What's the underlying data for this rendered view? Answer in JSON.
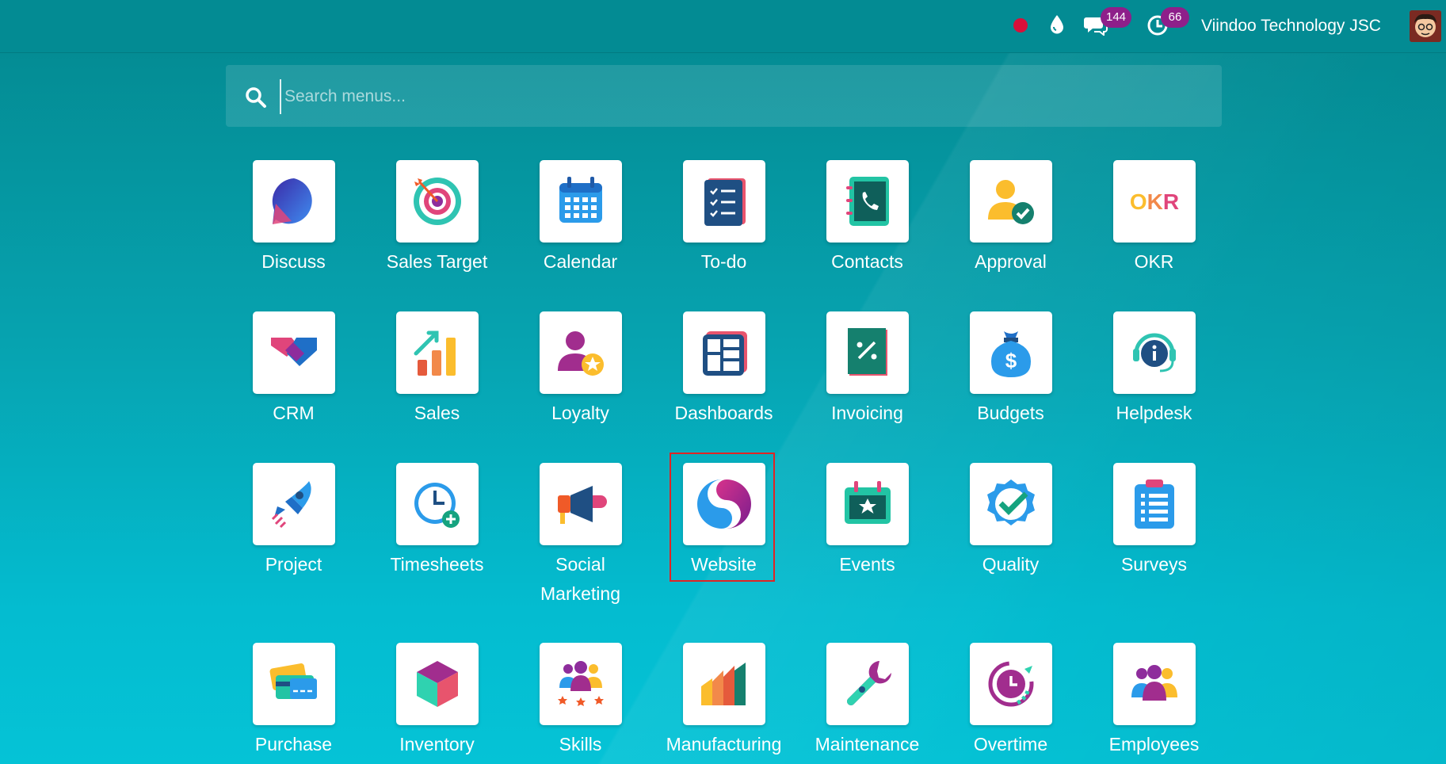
{
  "topbar": {
    "chat_count": "144",
    "activity_count": "66",
    "company_name": "Viindoo Technology JSC"
  },
  "search": {
    "placeholder": "Search menus..."
  },
  "apps": [
    {
      "label": "Discuss",
      "icon": "discuss-icon"
    },
    {
      "label": "Sales Target",
      "icon": "sales-target-icon"
    },
    {
      "label": "Calendar",
      "icon": "calendar-icon"
    },
    {
      "label": "To-do",
      "icon": "todo-icon"
    },
    {
      "label": "Contacts",
      "icon": "contacts-icon"
    },
    {
      "label": "Approval",
      "icon": "approval-icon"
    },
    {
      "label": "OKR",
      "icon": "okr-icon"
    },
    {
      "label": "CRM",
      "icon": "crm-icon"
    },
    {
      "label": "Sales",
      "icon": "sales-icon"
    },
    {
      "label": "Loyalty",
      "icon": "loyalty-icon"
    },
    {
      "label": "Dashboards",
      "icon": "dashboards-icon"
    },
    {
      "label": "Invoicing",
      "icon": "invoicing-icon"
    },
    {
      "label": "Budgets",
      "icon": "budgets-icon"
    },
    {
      "label": "Helpdesk",
      "icon": "helpdesk-icon"
    },
    {
      "label": "Project",
      "icon": "project-icon"
    },
    {
      "label": "Timesheets",
      "icon": "timesheets-icon"
    },
    {
      "label": "Social Marketing",
      "icon": "social-marketing-icon"
    },
    {
      "label": "Website",
      "icon": "website-icon",
      "selected": true
    },
    {
      "label": "Events",
      "icon": "events-icon"
    },
    {
      "label": "Quality",
      "icon": "quality-icon"
    },
    {
      "label": "Surveys",
      "icon": "surveys-icon"
    },
    {
      "label": "Purchase",
      "icon": "purchase-icon"
    },
    {
      "label": "Inventory",
      "icon": "inventory-icon"
    },
    {
      "label": "Skills",
      "icon": "skills-icon"
    },
    {
      "label": "Manufacturing",
      "icon": "manufacturing-icon"
    },
    {
      "label": "Maintenance",
      "icon": "maintenance-icon"
    },
    {
      "label": "Overtime",
      "icon": "overtime-icon"
    },
    {
      "label": "Employees",
      "icon": "employees-icon"
    }
  ]
}
